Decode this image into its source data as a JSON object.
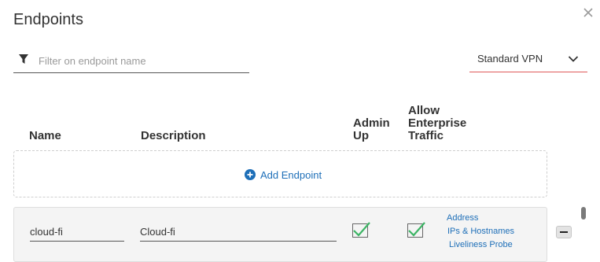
{
  "dialog": {
    "title": "Endpoints"
  },
  "filter": {
    "placeholder": "Filter on endpoint name",
    "value": ""
  },
  "vpn_select": {
    "selected": "Standard VPN"
  },
  "columns": {
    "name": "Name",
    "description": "Description",
    "admin_up": [
      "Admin",
      "Up"
    ],
    "allow_enterprise": [
      "Allow",
      "Enterprise",
      "Traffic"
    ]
  },
  "add_endpoint": {
    "label": "Add Endpoint"
  },
  "rows": [
    {
      "name": "cloud-fi",
      "description": "Cloud-fi",
      "admin_up": true,
      "allow_enterprise_traffic": true,
      "links": [
        "Address",
        "IPs & Hostnames",
        "Liveliness Probe"
      ]
    }
  ],
  "icons": {
    "close": "close-icon",
    "filter": "filter-icon",
    "dropdown": "chevron-down-icon",
    "add": "plus-circle-icon",
    "check": "checkmark-icon",
    "remove": "minus-icon"
  },
  "colors": {
    "accent_link": "#1e6fb8",
    "select_underline": "#e05a5a",
    "check_green": "#3cb464"
  }
}
